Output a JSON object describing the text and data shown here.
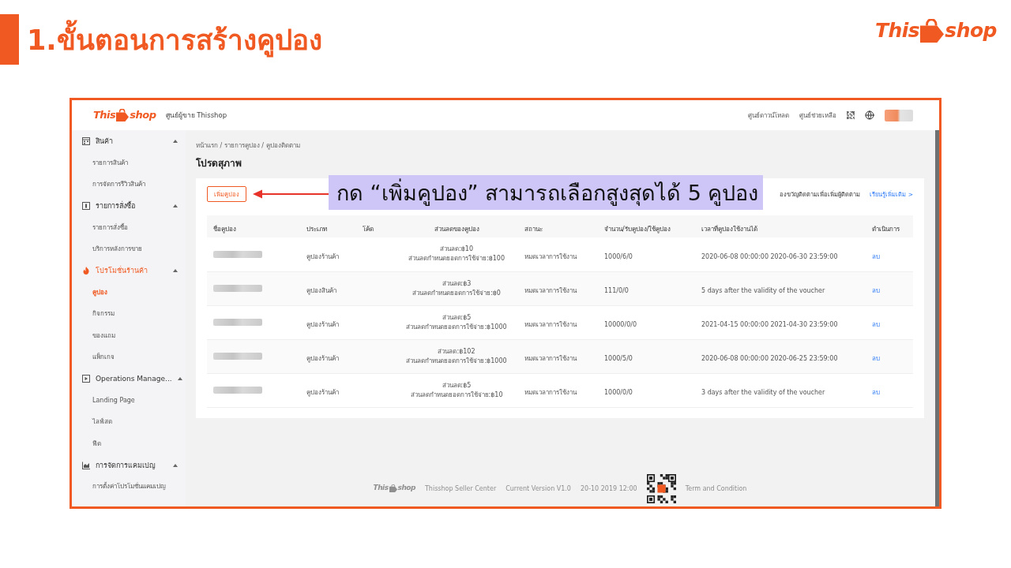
{
  "slide": {
    "title": "1.ขั้นตอนการสร้างคูปอง",
    "logo": {
      "left": "This",
      "right": "shop"
    }
  },
  "header": {
    "logo": {
      "left": "This",
      "right": "shop"
    },
    "center_name": "ศูนย์ผู้ขาย Thisshop",
    "links": [
      "ศูนย์ดาวน์โหลด",
      "ศูนย์ช่วยเหลือ"
    ]
  },
  "sidebar": {
    "sections": [
      {
        "label": "สินค้า",
        "expanded": true,
        "items": [
          {
            "label": "รายการสินค้า",
            "selected": false
          },
          {
            "label": "การจัดการรีวิวสินค้า",
            "selected": false
          }
        ]
      },
      {
        "label": "รายการสั่งซื้อ",
        "expanded": true,
        "items": [
          {
            "label": "รายการสั่งซื้อ",
            "selected": false
          },
          {
            "label": "บริการหลังการขาย",
            "selected": false
          }
        ]
      },
      {
        "label": "โปรโมชั่นร้านค้า",
        "expanded": true,
        "items": [
          {
            "label": "คูปอง",
            "selected": true
          },
          {
            "label": "กิจกรรม",
            "selected": false
          },
          {
            "label": "ของแถม",
            "selected": false
          },
          {
            "label": "แพ็กเกจ",
            "selected": false
          }
        ]
      },
      {
        "label": "Operations Manage...",
        "expanded": true,
        "items": [
          {
            "label": "Landing Page",
            "selected": false
          },
          {
            "label": "ไลฟ์สด",
            "selected": false
          },
          {
            "label": "ฟีด",
            "selected": false
          }
        ]
      },
      {
        "label": "การจัดการแคมเปญ",
        "expanded": true,
        "items": [
          {
            "label": "การตั้งค่าโปรโมชั่นแคมเปญ",
            "selected": false
          }
        ]
      }
    ]
  },
  "breadcrumb": "หน้าแรก / รายการคูปอง / คูปองติดตาม",
  "page_title": "โปรดสุภาพ",
  "toolbar": {
    "add_button": "เพิ่มคูปอง",
    "notice": "องขวัญติดตามเพื่อเพิ่มผู้ติดตาม",
    "link": "เรียนรู้เพิ่มเติม >"
  },
  "table": {
    "columns": [
      "ชื่อคูปอง",
      "ประเภท",
      "โค้ด",
      "ส่วนลดของคูปอง",
      "สถานะ",
      "จำนวน/รับคูปอง/ใช้คูปอง",
      "เวลาที่คูปองใช้งานได้",
      "ดำเนินการ"
    ],
    "rows": [
      {
        "type": "คูปองร้านค้า",
        "discount": "ส่วนลด:฿10",
        "min_spend": "ส่วนลดกำหนดยอดการใช้จ่าย:฿100",
        "status": "หมดเวลาการใช้งาน",
        "quantity": "1000/6/0",
        "valid_time": "2020-06-08 00:00:00 2020-06-30 23:59:00",
        "action": "ลบ"
      },
      {
        "type": "คูปองสินค้า",
        "discount": "ส่วนลด:฿3",
        "min_spend": "ส่วนลดกำหนดยอดการใช้จ่าย:฿0",
        "status": "หมดเวลาการใช้งาน",
        "quantity": "111/0/0",
        "valid_time": "5 days after the validity of the voucher",
        "action": "ลบ"
      },
      {
        "type": "คูปองร้านค้า",
        "discount": "ส่วนลด:฿5",
        "min_spend": "ส่วนลดกำหนดยอดการใช้จ่าย:฿1000",
        "status": "หมดเวลาการใช้งาน",
        "quantity": "10000/0/0",
        "valid_time": "2021-04-15 00:00:00 2021-04-30 23:59:00",
        "action": "ลบ"
      },
      {
        "type": "คูปองร้านค้า",
        "discount": "ส่วนลด:฿102",
        "min_spend": "ส่วนลดกำหนดยอดการใช้จ่าย:฿1000",
        "status": "หมดเวลาการใช้งาน",
        "quantity": "1000/5/0",
        "valid_time": "2020-06-08 00:00:00 2020-06-25 23:59:00",
        "action": "ลบ"
      },
      {
        "type": "คูปองร้านค้า",
        "discount": "ส่วนลด:฿5",
        "min_spend": "ส่วนลดกำหนดยอดการใช้จ่าย:฿10",
        "status": "หมดเวลาการใช้งาน",
        "quantity": "1000/0/0",
        "valid_time": "3 days after the validity of the voucher",
        "action": "ลบ"
      }
    ]
  },
  "footer": {
    "logo": {
      "left": "This",
      "right": "shop"
    },
    "info": [
      "Thisshop Seller Center",
      "Current Version V1.0",
      "20-10 2019 12:00"
    ],
    "terms": "Term and Condition"
  },
  "annotation": {
    "callout": "กด “เพิ่มคูปอง” สามารถเลือกสูงสุดได้ 5 คูปอง"
  }
}
